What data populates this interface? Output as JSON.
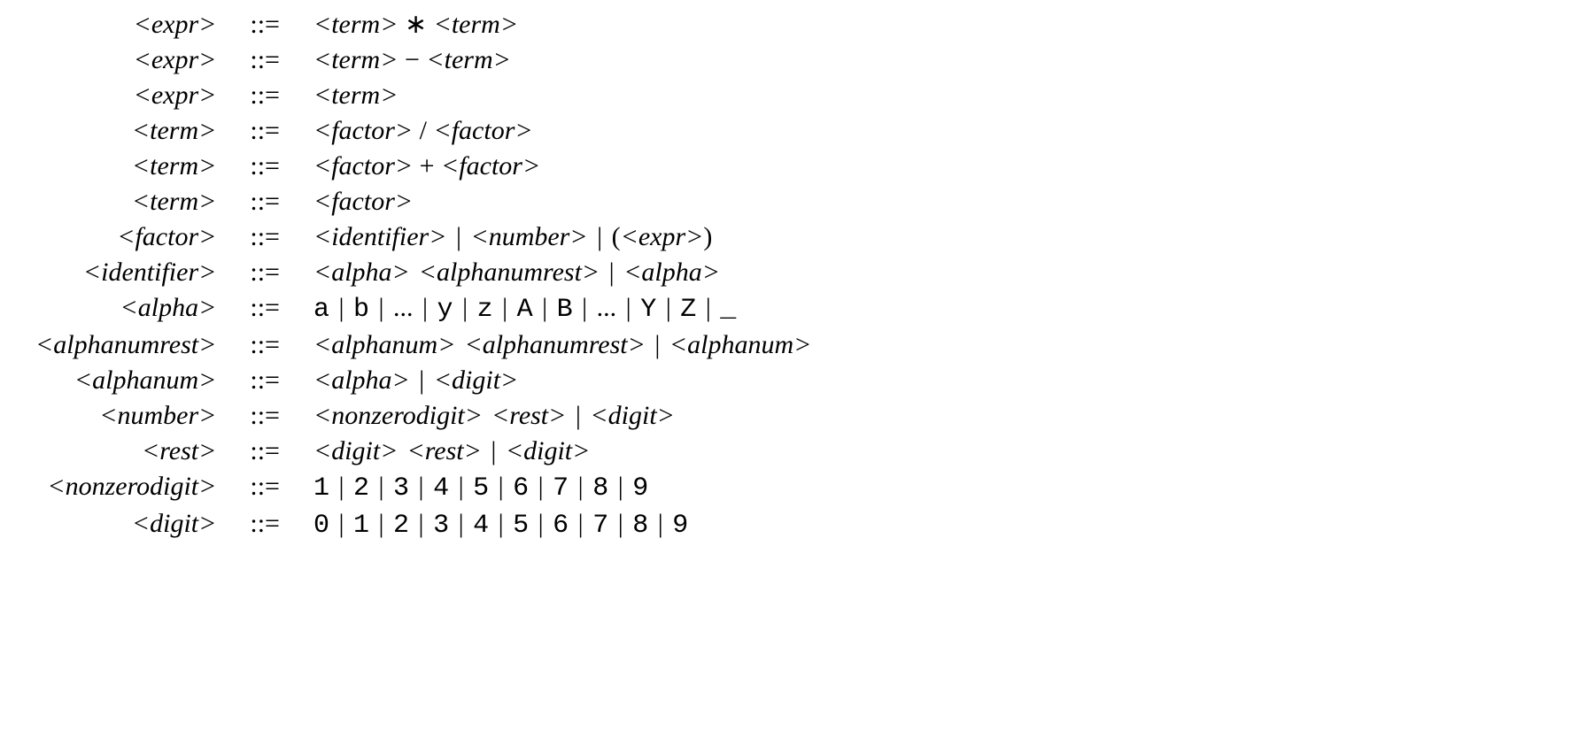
{
  "rules": [
    {
      "lhs": "<expr>",
      "rhs": [
        {
          "nt": "<term>"
        },
        {
          "sym": " ∗ "
        },
        {
          "nt": "<term>"
        }
      ]
    },
    {
      "lhs": "<expr>",
      "rhs": [
        {
          "nt": "<term>"
        },
        {
          "sym": " − "
        },
        {
          "nt": "<term>"
        }
      ]
    },
    {
      "lhs": "<expr>",
      "rhs": [
        {
          "nt": "<term>"
        }
      ]
    },
    {
      "lhs": "<term>",
      "rhs": [
        {
          "nt": "<factor>"
        },
        {
          "sym": " / "
        },
        {
          "nt": "<factor>"
        }
      ]
    },
    {
      "lhs": "<term>",
      "rhs": [
        {
          "nt": "<factor>"
        },
        {
          "sym": " + "
        },
        {
          "nt": "<factor>"
        }
      ]
    },
    {
      "lhs": "<term>",
      "rhs": [
        {
          "nt": "<factor>"
        }
      ]
    },
    {
      "lhs": "<factor>",
      "rhs": [
        {
          "nt": "<identifier>"
        },
        {
          "bar": "|"
        },
        {
          "nt": "<number>"
        },
        {
          "bar": "|"
        },
        {
          "sym": "("
        },
        {
          "nt": "<expr>"
        },
        {
          "sym": ")"
        }
      ]
    },
    {
      "lhs": "<identifier>",
      "rhs": [
        {
          "nt": "<alpha>"
        },
        {
          "sp": true
        },
        {
          "nt": "<alphanumrest>"
        },
        {
          "bar": "|"
        },
        {
          "nt": "<alpha>"
        }
      ]
    },
    {
      "lhs": "<alpha>",
      "rhs": [
        {
          "t": "a"
        },
        {
          "bar": "|"
        },
        {
          "t": "b"
        },
        {
          "bar": "|"
        },
        {
          "sym": "..."
        },
        {
          "bar": "|"
        },
        {
          "t": "y"
        },
        {
          "bar": "|"
        },
        {
          "t": "z"
        },
        {
          "bar": "|"
        },
        {
          "t": "A"
        },
        {
          "bar": "|"
        },
        {
          "t": "B"
        },
        {
          "bar": "|"
        },
        {
          "sym": "..."
        },
        {
          "bar": "|"
        },
        {
          "t": "Y"
        },
        {
          "bar": "|"
        },
        {
          "t": "Z"
        },
        {
          "bar": "|"
        },
        {
          "t": "_"
        }
      ]
    },
    {
      "lhs": "<alphanumrest>",
      "rhs": [
        {
          "nt": "<alphanum>"
        },
        {
          "sp": true
        },
        {
          "nt": "<alphanumrest>"
        },
        {
          "bar": "|"
        },
        {
          "nt": "<alphanum>"
        }
      ]
    },
    {
      "lhs": "<alphanum>",
      "rhs": [
        {
          "nt": "<alpha>"
        },
        {
          "bar": "|"
        },
        {
          "nt": "<digit>"
        }
      ]
    },
    {
      "lhs": "<number>",
      "rhs": [
        {
          "nt": "<nonzerodigit>"
        },
        {
          "sp": true
        },
        {
          "nt": "<rest>"
        },
        {
          "bar": "|"
        },
        {
          "nt": "<digit>"
        }
      ]
    },
    {
      "lhs": "<rest>",
      "rhs": [
        {
          "nt": "<digit>"
        },
        {
          "sp": true
        },
        {
          "nt": "<rest>"
        },
        {
          "bar": "|"
        },
        {
          "nt": "<digit>"
        }
      ]
    },
    {
      "lhs": "<nonzerodigit>",
      "rhs": [
        {
          "t": "1"
        },
        {
          "bar": "|"
        },
        {
          "t": "2"
        },
        {
          "bar": "|"
        },
        {
          "t": "3"
        },
        {
          "bar": "|"
        },
        {
          "t": "4"
        },
        {
          "bar": "|"
        },
        {
          "t": "5"
        },
        {
          "bar": "|"
        },
        {
          "t": "6"
        },
        {
          "bar": "|"
        },
        {
          "t": "7"
        },
        {
          "bar": "|"
        },
        {
          "t": "8"
        },
        {
          "bar": "|"
        },
        {
          "t": "9"
        }
      ]
    },
    {
      "lhs": "<digit>",
      "rhs": [
        {
          "t": "0"
        },
        {
          "bar": "|"
        },
        {
          "t": "1"
        },
        {
          "bar": "|"
        },
        {
          "t": "2"
        },
        {
          "bar": "|"
        },
        {
          "t": "3"
        },
        {
          "bar": "|"
        },
        {
          "t": "4"
        },
        {
          "bar": "|"
        },
        {
          "t": "5"
        },
        {
          "bar": "|"
        },
        {
          "t": "6"
        },
        {
          "bar": "|"
        },
        {
          "t": "7"
        },
        {
          "bar": "|"
        },
        {
          "t": "8"
        },
        {
          "bar": "|"
        },
        {
          "t": "9"
        }
      ]
    }
  ],
  "defines": "::="
}
